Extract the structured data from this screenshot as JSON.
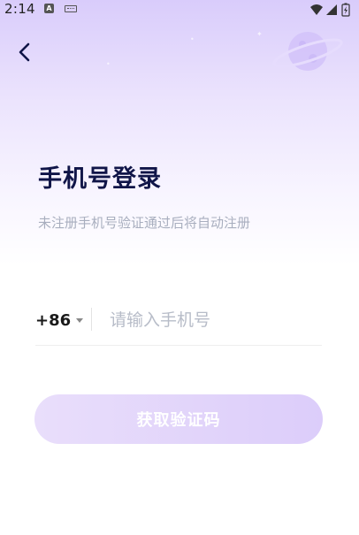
{
  "status_bar": {
    "time": "2:14",
    "notification_badge": "A",
    "icons": [
      "a-notification-icon",
      "keyboard-icon",
      "wifi-icon",
      "signal-icon",
      "battery-icon"
    ]
  },
  "header": {
    "back_icon": "chevron-left-icon",
    "decoration_icon": "planet-icon"
  },
  "login": {
    "title": "手机号登录",
    "subtitle": "未注册手机号验证通过后将自动注册",
    "country_code": "+86",
    "phone_placeholder": "请输入手机号",
    "phone_value": "",
    "submit_label": "获取验证码"
  },
  "colors": {
    "title": "#101548",
    "subtitle": "#a8aebe",
    "accent_light": "#e9defb",
    "accent": "#dccdfa",
    "background_top": "#d9ccfb"
  }
}
